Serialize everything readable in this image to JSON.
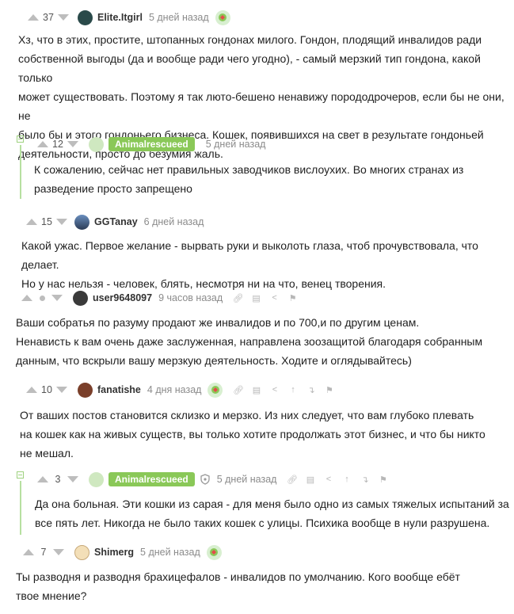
{
  "comments": [
    {
      "score": "37",
      "author": "Elite.Itgirl",
      "time": "5 дней назад",
      "lines": [
        "Хз, что в этих, простите, штопанных гондонах милого. Гондон, плодящий инвалидов ради",
        "собственной выгоды (да и вообще ради чего угодно), - самый мерзкий тип гондона, какой только",
        "может существовать. Поэтому я так люто-бешено ненавижу порододрочеров, если бы не они, не",
        "было бы и этого гондоньего бизнеса. Кошек, появившихся на свет в результате гондоньей",
        "деятельности, просто до безумия жаль."
      ]
    },
    {
      "score": "12",
      "author": "Animalrescueed",
      "time": "5 дней назад",
      "lines": [
        "К сожалению, сейчас нет правильных заводчиков вислоухих. Во многих странах из",
        "разведение просто запрещено"
      ]
    },
    {
      "score": "15",
      "author": "GGTanay",
      "time": "6 дней назад",
      "lines": [
        "Какой ужас. Первое желание - вырвать руки и выколоть глаза, чтоб прочувствовала, что делает.",
        "Но у нас нельзя - человек, блять, несмотря ни на что, венец творения."
      ]
    },
    {
      "score": "",
      "author": "user9648097",
      "time": "9 часов назад",
      "lines": [
        "Ваши собратья по разуму продают же инвалидов и по 700,и по другим ценам.",
        "Ненависть к вам очень даже заслуженная, направлена зоозащитой благодаря собранным",
        "данным, что вскрыли вашу мерзкую деятельность. Ходите и оглядывайтесь)"
      ]
    },
    {
      "score": "10",
      "author": "fanatishe",
      "time": "4 дня назад",
      "lines": [
        "От ваших постов становится склизко и мерзко. Из них следует, что вам глубоко плевать",
        "на кошек как на живых существ, вы только хотите продолжать этот бизнес, и что бы никто",
        "не мешал."
      ]
    },
    {
      "score": "3",
      "author": "Animalrescueed",
      "time": "5 дней назад",
      "lines": [
        "Да она больная. Эти кошки из сарая - для меня было одно из самых тяжелых испытаний за",
        "все пять лет. Никогда не было таких кошек с улицы. Психика вообще в нули разрушена."
      ]
    },
    {
      "score": "7",
      "author": "Shimerg",
      "time": "5 дней назад",
      "lines": [
        "Ты разводня и разводня брахицефалов - инвалидов по умолчанию. Кого вообще ебёт",
        "твое мнение?"
      ]
    }
  ],
  "colors": {
    "accent": "#8ac858",
    "branch": "#b7e0a1",
    "meta": "#8b8b8b"
  },
  "icons": {
    "upvote": "arrow-up-icon",
    "downvote": "arrow-down-icon",
    "link": "link-icon",
    "save": "save-icon",
    "share": "share-icon",
    "up_branch": "go-up-icon",
    "reply_branch": "go-to-parent-icon",
    "report": "flag-icon",
    "award": "award-icon",
    "moderator": "shield-icon"
  }
}
